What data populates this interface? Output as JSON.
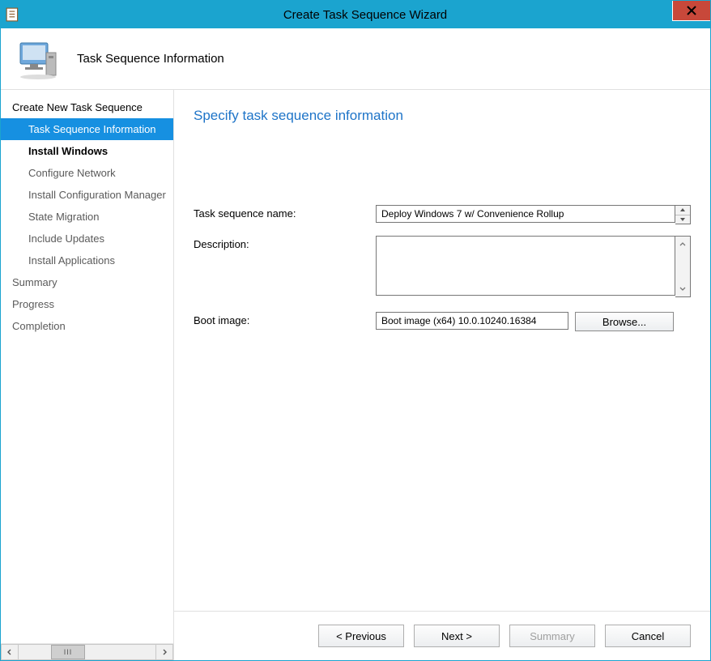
{
  "window": {
    "title": "Create Task Sequence Wizard"
  },
  "header": {
    "title": "Task Sequence Information"
  },
  "sidebar": {
    "items": [
      {
        "label": "Create New Task Sequence",
        "level": 0,
        "state": "normal"
      },
      {
        "label": "Task Sequence Information",
        "level": 1,
        "state": "selected"
      },
      {
        "label": "Install Windows",
        "level": 1,
        "state": "bold"
      },
      {
        "label": "Configure Network",
        "level": 1,
        "state": "muted"
      },
      {
        "label": "Install Configuration Manager",
        "level": 1,
        "state": "muted"
      },
      {
        "label": "State Migration",
        "level": 1,
        "state": "muted"
      },
      {
        "label": "Include Updates",
        "level": 1,
        "state": "muted"
      },
      {
        "label": "Install Applications",
        "level": 1,
        "state": "muted"
      },
      {
        "label": "Summary",
        "level": 0,
        "state": "muted"
      },
      {
        "label": "Progress",
        "level": 0,
        "state": "muted"
      },
      {
        "label": "Completion",
        "level": 0,
        "state": "muted"
      }
    ],
    "thumb_grip": "III"
  },
  "main": {
    "heading": "Specify task sequence information",
    "labels": {
      "name": "Task sequence name:",
      "description": "Description:",
      "boot": "Boot image:"
    },
    "values": {
      "name": "Deploy Windows 7 w/ Convenience Rollup",
      "description": "",
      "boot": "Boot image (x64) 10.0.10240.16384"
    },
    "browse_label": "Browse..."
  },
  "footer": {
    "previous": "< Previous",
    "next": "Next >",
    "summary": "Summary",
    "cancel": "Cancel"
  }
}
